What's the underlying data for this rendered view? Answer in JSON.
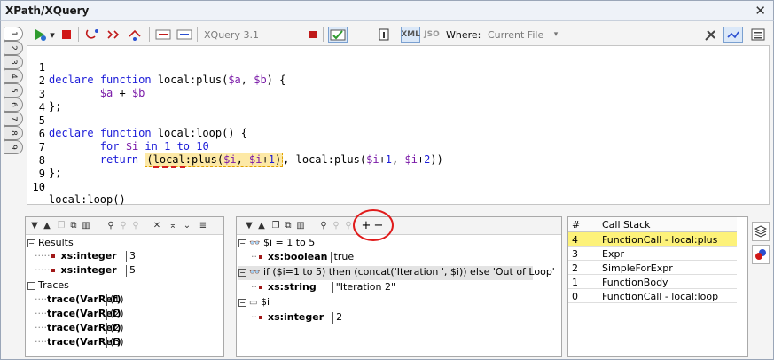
{
  "window": {
    "title": "XPath/XQuery",
    "close_glyph": "✕"
  },
  "tabs": [
    "1",
    "2",
    "3",
    "4",
    "5",
    "6",
    "7",
    "8",
    "9"
  ],
  "toolbar": {
    "language_value": "XQuery 3.1",
    "xml_label": "XML",
    "json_label": "JSO",
    "where_label": "Where:",
    "where_value": "Current File"
  },
  "editor": {
    "line_numbers": [
      "1",
      "2",
      "3",
      "4",
      "5",
      "6",
      "7",
      "8",
      "9",
      "10"
    ]
  },
  "results_panel": {
    "groups": [
      {
        "label": "Results",
        "items": [
          {
            "type": "xs:integer",
            "value": "3"
          },
          {
            "type": "xs:integer",
            "value": "5"
          }
        ]
      },
      {
        "label": "Traces",
        "items": [
          {
            "type": "trace(VarRef)",
            "value": "(1)"
          },
          {
            "type": "trace(VarRef)",
            "value": "(2)"
          },
          {
            "type": "trace(VarRef)",
            "value": "(2)"
          },
          {
            "type": "trace(VarRef)",
            "value": "(3)"
          }
        ]
      }
    ]
  },
  "watch_panel": {
    "add_label": "+",
    "remove_label": "−",
    "items": [
      {
        "expr": "$i = 1 to 5",
        "type": "xs:boolean",
        "value": "true"
      },
      {
        "expr": "if ($i=1 to 5) then (concat('Iteration ', $i)) else 'Out of Loop'",
        "type": "xs:string",
        "value": "\"Iteration 2\""
      },
      {
        "expr": "$i",
        "type": "xs:integer",
        "value": "2"
      }
    ]
  },
  "callstack_panel": {
    "col_num": "#",
    "col_name": "Call Stack",
    "rows": [
      {
        "num": "4",
        "name": "FunctionCall - local:plus"
      },
      {
        "num": "3",
        "name": "Expr"
      },
      {
        "num": "2",
        "name": "SimpleForExpr"
      },
      {
        "num": "1",
        "name": "FunctionBody"
      },
      {
        "num": "0",
        "name": "FunctionCall - local:loop"
      }
    ]
  },
  "colors": {
    "highlight": "#fde9a6",
    "selected_row": "#fdf27a",
    "annotation": "#e01b1b",
    "keyword": "#1b1bd8",
    "variable": "#7a1aa8"
  }
}
